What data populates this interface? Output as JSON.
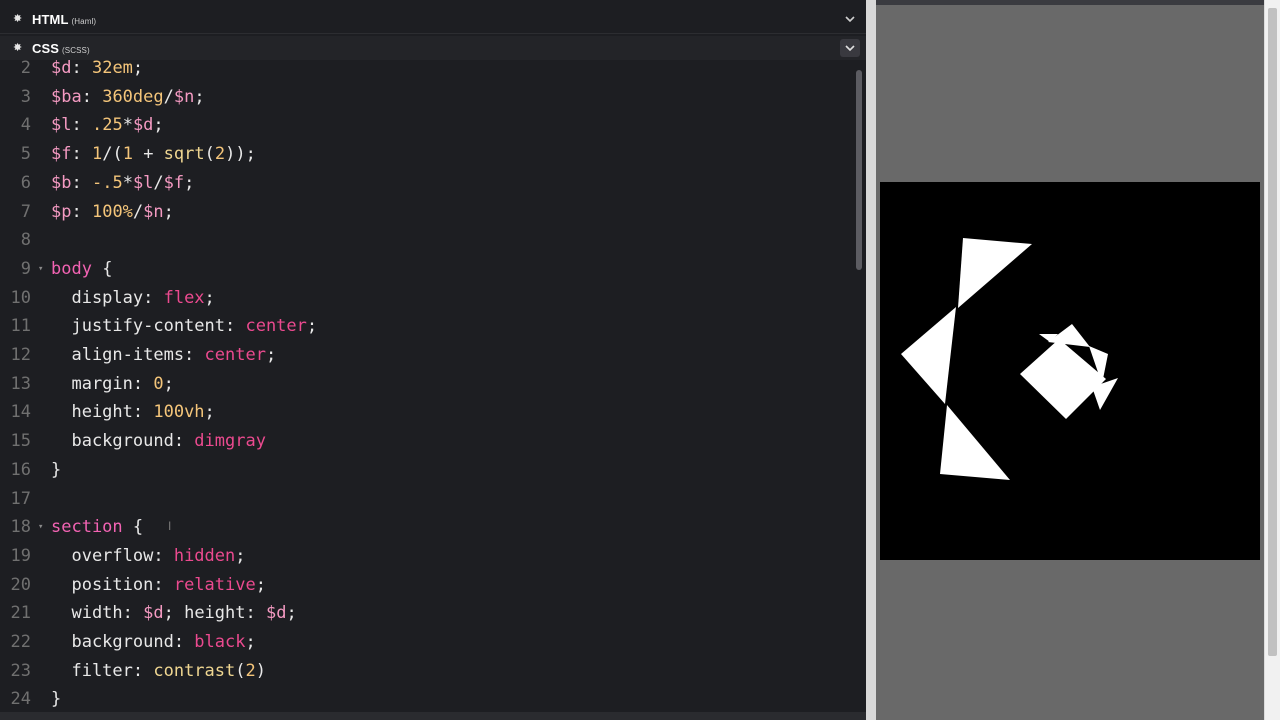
{
  "panels": {
    "html": {
      "title": "HTML",
      "preprocessor": "(Haml)"
    },
    "css": {
      "title": "CSS",
      "preprocessor": "(SCSS)"
    }
  },
  "icons": {
    "settings": "gear-icon",
    "collapse": "chevron-down-icon"
  },
  "colors": {
    "editor_bg": "#1d1e22",
    "preview_bg": "#696969",
    "stage_bg": "#000000",
    "shape": "#ffffff"
  },
  "code": {
    "lines": [
      {
        "n": "2",
        "fold": "",
        "t": [
          [
            "var",
            "$d"
          ],
          [
            "p",
            ": "
          ],
          [
            "num",
            "32em"
          ],
          [
            "p",
            ";"
          ]
        ]
      },
      {
        "n": "3",
        "fold": "",
        "t": [
          [
            "var",
            "$ba"
          ],
          [
            "p",
            ": "
          ],
          [
            "num",
            "360deg"
          ],
          [
            "p",
            "/"
          ],
          [
            "var",
            "$n"
          ],
          [
            "p",
            ";"
          ]
        ]
      },
      {
        "n": "4",
        "fold": "",
        "t": [
          [
            "var",
            "$l"
          ],
          [
            "p",
            ": "
          ],
          [
            "num",
            ".25"
          ],
          [
            "p",
            "*"
          ],
          [
            "var",
            "$d"
          ],
          [
            "p",
            ";"
          ]
        ]
      },
      {
        "n": "5",
        "fold": "",
        "t": [
          [
            "var",
            "$f"
          ],
          [
            "p",
            ": "
          ],
          [
            "num",
            "1"
          ],
          [
            "p",
            "/("
          ],
          [
            "num",
            "1"
          ],
          [
            "p",
            " + "
          ],
          [
            "fn",
            "sqrt"
          ],
          [
            "p",
            "("
          ],
          [
            "num",
            "2"
          ],
          [
            "p",
            "));"
          ]
        ]
      },
      {
        "n": "6",
        "fold": "",
        "t": [
          [
            "var",
            "$b"
          ],
          [
            "p",
            ": "
          ],
          [
            "num",
            "-.5"
          ],
          [
            "p",
            "*"
          ],
          [
            "var",
            "$l"
          ],
          [
            "p",
            "/"
          ],
          [
            "var",
            "$f"
          ],
          [
            "p",
            ";"
          ]
        ]
      },
      {
        "n": "7",
        "fold": "",
        "t": [
          [
            "var",
            "$p"
          ],
          [
            "p",
            ": "
          ],
          [
            "num",
            "100%"
          ],
          [
            "p",
            "/"
          ],
          [
            "var",
            "$n"
          ],
          [
            "p",
            ";"
          ]
        ]
      },
      {
        "n": "8",
        "fold": "",
        "t": []
      },
      {
        "n": "9",
        "fold": "▾",
        "t": [
          [
            "sel",
            "body"
          ],
          [
            "p",
            " {"
          ]
        ]
      },
      {
        "n": "10",
        "fold": "",
        "t": [
          [
            "p",
            "  display: "
          ],
          [
            "kw",
            "flex"
          ],
          [
            "p",
            ";"
          ]
        ]
      },
      {
        "n": "11",
        "fold": "",
        "t": [
          [
            "p",
            "  justify-content: "
          ],
          [
            "kw",
            "center"
          ],
          [
            "p",
            ";"
          ]
        ]
      },
      {
        "n": "12",
        "fold": "",
        "t": [
          [
            "p",
            "  align-items: "
          ],
          [
            "kw",
            "center"
          ],
          [
            "p",
            ";"
          ]
        ]
      },
      {
        "n": "13",
        "fold": "",
        "t": [
          [
            "p",
            "  margin: "
          ],
          [
            "num",
            "0"
          ],
          [
            "p",
            ";"
          ]
        ]
      },
      {
        "n": "14",
        "fold": "",
        "t": [
          [
            "p",
            "  height: "
          ],
          [
            "num",
            "100vh"
          ],
          [
            "p",
            ";"
          ]
        ]
      },
      {
        "n": "15",
        "fold": "",
        "t": [
          [
            "p",
            "  background: "
          ],
          [
            "kw",
            "dimgray"
          ]
        ]
      },
      {
        "n": "16",
        "fold": "",
        "t": [
          [
            "p",
            "}"
          ]
        ]
      },
      {
        "n": "17",
        "fold": "",
        "t": []
      },
      {
        "n": "18",
        "fold": "▾",
        "t": [
          [
            "sel",
            "section"
          ],
          [
            "p",
            " {"
          ]
        ]
      },
      {
        "n": "19",
        "fold": "",
        "t": [
          [
            "p",
            "  overflow: "
          ],
          [
            "kw",
            "hidden"
          ],
          [
            "p",
            ";"
          ]
        ]
      },
      {
        "n": "20",
        "fold": "",
        "t": [
          [
            "p",
            "  position: "
          ],
          [
            "kw",
            "relative"
          ],
          [
            "p",
            ";"
          ]
        ]
      },
      {
        "n": "21",
        "fold": "",
        "t": [
          [
            "p",
            "  width: "
          ],
          [
            "var",
            "$d"
          ],
          [
            "p",
            "; height: "
          ],
          [
            "var",
            "$d"
          ],
          [
            "p",
            ";"
          ]
        ]
      },
      {
        "n": "22",
        "fold": "",
        "t": [
          [
            "p",
            "  background: "
          ],
          [
            "kw",
            "black"
          ],
          [
            "p",
            ";"
          ]
        ]
      },
      {
        "n": "23",
        "fold": "",
        "t": [
          [
            "p",
            "  filter: "
          ],
          [
            "fn",
            "contrast"
          ],
          [
            "p",
            "("
          ],
          [
            "num",
            "2"
          ],
          [
            "p",
            ")"
          ]
        ]
      },
      {
        "n": "24",
        "fold": "",
        "t": [
          [
            "p",
            "}"
          ]
        ]
      }
    ]
  }
}
